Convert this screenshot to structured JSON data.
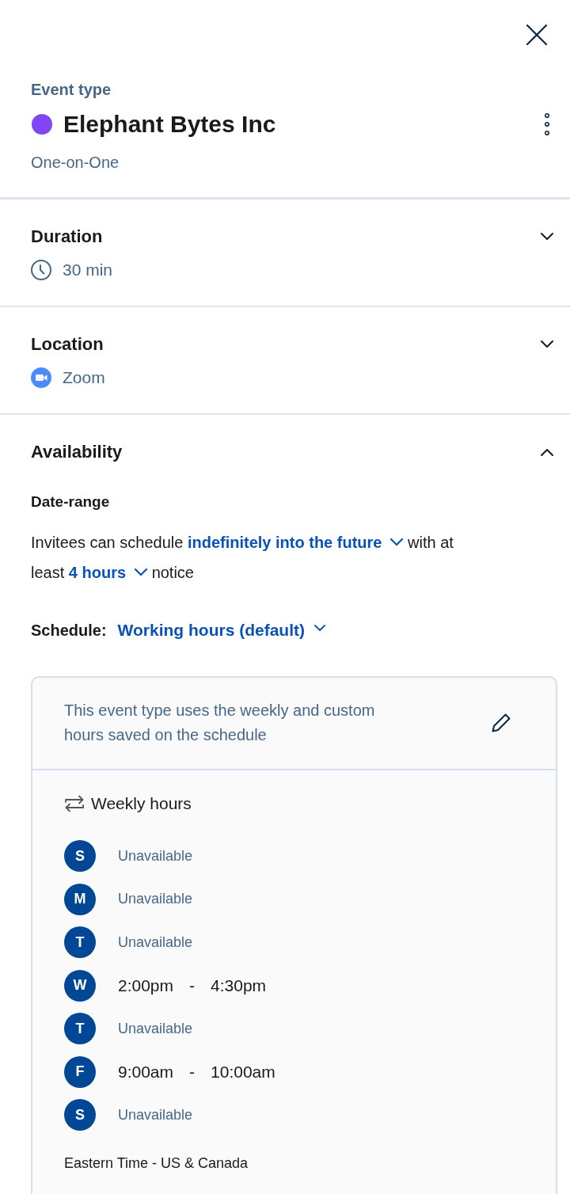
{
  "event": {
    "eyebrow": "Event type",
    "name": "Elephant Bytes Inc",
    "color": "#8247f5",
    "subtitle": "One-on-One"
  },
  "sections": [
    {
      "kind": "duration",
      "title": "Duration",
      "expanded": false,
      "value": "30 min"
    },
    {
      "kind": "location",
      "title": "Location",
      "expanded": false,
      "value": "Zoom"
    },
    {
      "kind": "availability",
      "title": "Availability",
      "expanded": true,
      "date_range_heading": "Date-range",
      "segments": [
        {
          "kind": "text",
          "text": "Invitees can schedule"
        },
        {
          "kind": "dropdown",
          "text": "indefinitely into the future"
        },
        {
          "kind": "text",
          "text": "with at least"
        },
        {
          "kind": "dropdown",
          "text": "4 hours"
        },
        {
          "kind": "text",
          "text": "notice"
        }
      ],
      "schedule_label": "Schedule:",
      "schedule_value": "Working hours (default)",
      "card": {
        "note": "This event type uses the weekly and custom hours saved on the schedule",
        "weekly_title": "Weekly hours",
        "days": [
          {
            "letter": "S",
            "kind": "unavailable",
            "text": "Unavailable"
          },
          {
            "letter": "M",
            "kind": "unavailable",
            "text": "Unavailable"
          },
          {
            "letter": "T",
            "kind": "unavailable",
            "text": "Unavailable"
          },
          {
            "letter": "W",
            "kind": "hours",
            "start": "2:00pm",
            "separator": "-",
            "end": "4:30pm"
          },
          {
            "letter": "T",
            "kind": "unavailable",
            "text": "Unavailable"
          },
          {
            "letter": "F",
            "kind": "hours",
            "start": "9:00am",
            "separator": "-",
            "end": "10:00am"
          },
          {
            "letter": "S",
            "kind": "unavailable",
            "text": "Unavailable"
          }
        ],
        "timezone": "Eastern Time - US & Canada"
      }
    }
  ]
}
